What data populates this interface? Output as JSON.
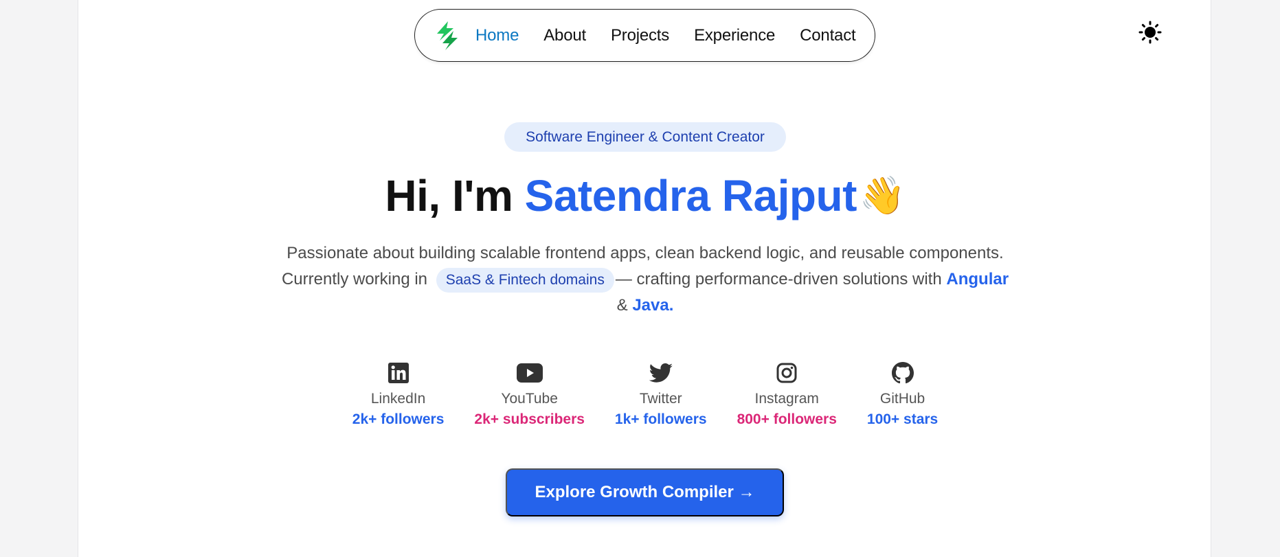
{
  "nav": {
    "logo": "lightning-logo-icon",
    "links": [
      "Home",
      "About",
      "Projects",
      "Experience",
      "Contact"
    ],
    "active": "Home",
    "theme_toggle": "sun-icon"
  },
  "hero": {
    "badge": "Software Engineer & Content Creator",
    "greeting": "Hi, I'm",
    "name": "Satendra Rajput",
    "wave": "👋",
    "desc_line1": "Passionate about building scalable frontend apps, clean backend logic, and reusable components.",
    "desc_prefix": "Currently working in",
    "desc_pill": "SaaS & Fintech domains",
    "desc_mid": "— crafting performance-driven solutions with",
    "desc_tech1": "Angular",
    "desc_amp": "&",
    "desc_tech2": "Java."
  },
  "socials": [
    {
      "icon": "linkedin-icon",
      "label": "LinkedIn",
      "count": "2k+ followers",
      "color": "#2563eb"
    },
    {
      "icon": "youtube-icon",
      "label": "YouTube",
      "count": "2k+ subscribers",
      "color": "#db2777"
    },
    {
      "icon": "twitter-icon",
      "label": "Twitter",
      "count": "1k+ followers",
      "color": "#2563eb"
    },
    {
      "icon": "instagram-icon",
      "label": "Instagram",
      "count": "800+ followers",
      "color": "#db2777"
    },
    {
      "icon": "github-icon",
      "label": "GitHub",
      "count": "100+ stars",
      "color": "#2563eb"
    }
  ],
  "cta": {
    "label": "Explore Growth Compiler →"
  },
  "colors": {
    "accent": "#2563eb",
    "pink": "#db2777",
    "nav_active": "#0c78c2",
    "logo": "#22c55e"
  }
}
